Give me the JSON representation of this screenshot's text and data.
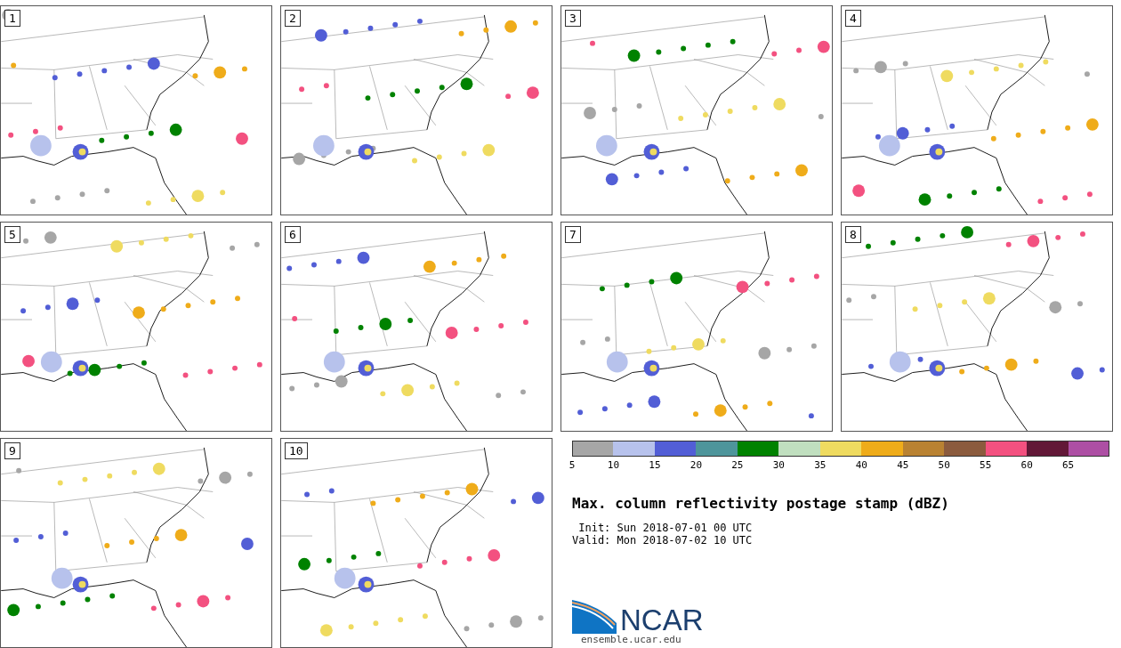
{
  "panels": [
    {
      "number": "1"
    },
    {
      "number": "2"
    },
    {
      "number": "3"
    },
    {
      "number": "4"
    },
    {
      "number": "5"
    },
    {
      "number": "6"
    },
    {
      "number": "7"
    },
    {
      "number": "8"
    },
    {
      "number": "9"
    },
    {
      "number": "10"
    }
  ],
  "colorbar": {
    "bins": [
      {
        "tick": "5",
        "color": "#a6a6a6"
      },
      {
        "tick": "10",
        "color": "#b7c2ec"
      },
      {
        "tick": "15",
        "color": "#525ed6"
      },
      {
        "tick": "20",
        "color": "#4e959b"
      },
      {
        "tick": "25",
        "color": "#008200"
      },
      {
        "tick": "30",
        "color": "#c0dfbf"
      },
      {
        "tick": "35",
        "color": "#efdb60"
      },
      {
        "tick": "40",
        "color": "#efac1a"
      },
      {
        "tick": "45",
        "color": "#b98232"
      },
      {
        "tick": "50",
        "color": "#8b5b3e"
      },
      {
        "tick": "55",
        "color": "#f35180"
      },
      {
        "tick": "60",
        "color": "#621837"
      },
      {
        "tick": "65",
        "color": "#ad4fa4"
      }
    ]
  },
  "title": "Max. column reflectivity postage stamp (dBZ)",
  "init": " Init: Sun 2018-07-01 00 UTC",
  "valid": "Valid: Mon 2018-07-02 10 UTC",
  "logo": {
    "text": "NCAR",
    "url": "ensemble.ucar.edu"
  }
}
